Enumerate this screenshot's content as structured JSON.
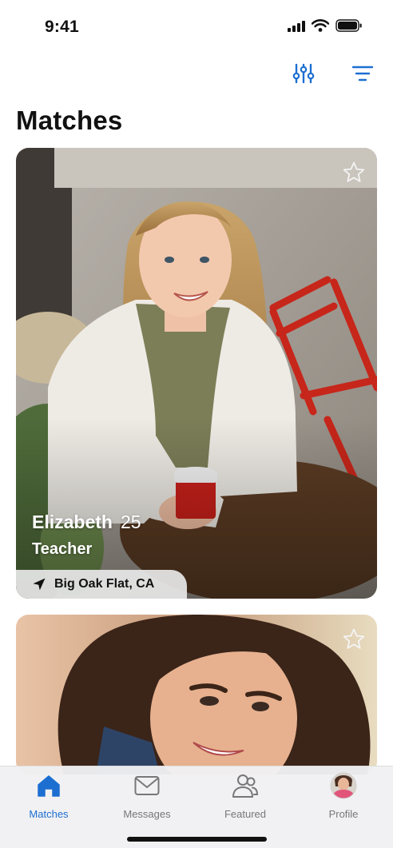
{
  "status_bar": {
    "time": "9:41"
  },
  "page": {
    "title": "Matches"
  },
  "colors": {
    "accent": "#1c6fd1",
    "inactive": "#777777"
  },
  "matches": [
    {
      "name": "Elizabeth",
      "age": "25",
      "occupation": "Teacher",
      "location": "Big Oak Flat, CA",
      "favorite_icon": "star-outline-icon"
    },
    {
      "favorite_icon": "star-outline-icon"
    }
  ],
  "tab_bar": {
    "tabs": [
      {
        "label": "Matches",
        "icon": "home-icon",
        "active": true
      },
      {
        "label": "Messages",
        "icon": "envelope-icon",
        "active": false
      },
      {
        "label": "Featured",
        "icon": "people-icon",
        "active": false
      },
      {
        "label": "Profile",
        "icon": "avatar",
        "active": false
      }
    ]
  }
}
